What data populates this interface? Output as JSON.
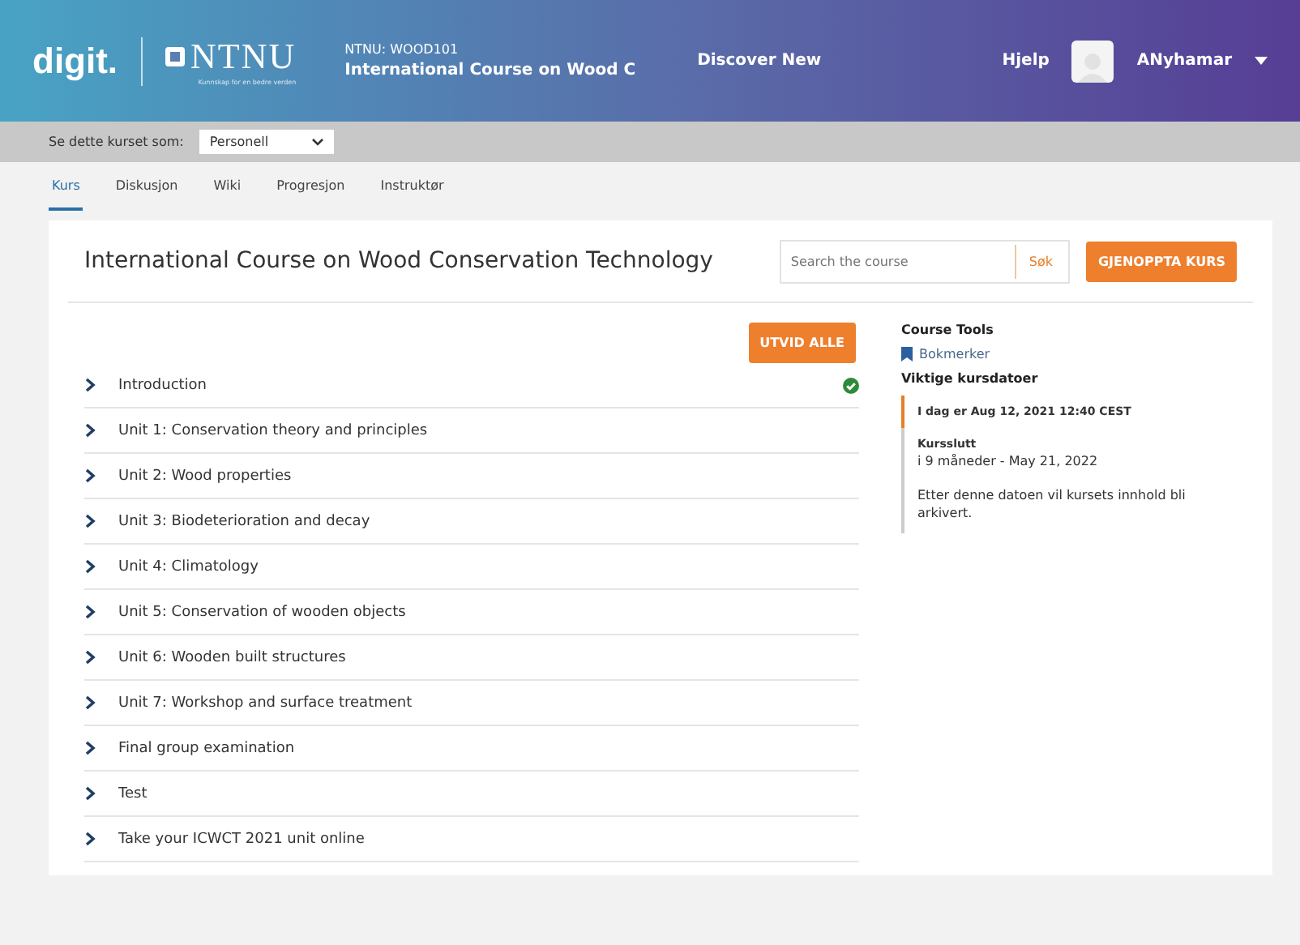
{
  "header": {
    "brand": "digit.",
    "logo": "NTNU",
    "tagline": "Kunnskap for en bedre verden",
    "course_code": "NTNU: WOOD101",
    "course_title": "International Course on Wood C",
    "nav_link": "Discover New",
    "help": "Hjelp",
    "username": "ANyhamar"
  },
  "view_as": {
    "label": "Se dette kurset som:",
    "value": "Personell"
  },
  "tabs": [
    {
      "label": "Kurs",
      "selected": true
    },
    {
      "label": "Diskusjon",
      "selected": false
    },
    {
      "label": "Wiki",
      "selected": false
    },
    {
      "label": "Progresjon",
      "selected": false
    },
    {
      "label": "Instruktør",
      "selected": false
    }
  ],
  "course": {
    "title": "International Course on Wood Conservation Technology",
    "search_placeholder": "Search the course",
    "search_button": "Søk",
    "resume_button": "GJENOPPTA KURS",
    "expand_button": "UTVID ALLE"
  },
  "sections": [
    {
      "title": "Introduction",
      "completed": true
    },
    {
      "title": "Unit 1: Conservation theory and principles",
      "completed": false
    },
    {
      "title": "Unit 2: Wood properties",
      "completed": false
    },
    {
      "title": "Unit 3: Biodeterioration and decay",
      "completed": false
    },
    {
      "title": "Unit 4: Climatology",
      "completed": false
    },
    {
      "title": "Unit 5: Conservation of wooden objects",
      "completed": false
    },
    {
      "title": "Unit 6: Wooden built structures",
      "completed": false
    },
    {
      "title": "Unit 7: Workshop and surface treatment",
      "completed": false
    },
    {
      "title": "Final group examination",
      "completed": false
    },
    {
      "title": "Test",
      "completed": false
    },
    {
      "title": "Take your ICWCT 2021 unit online",
      "completed": false
    }
  ],
  "sidebar": {
    "tools_heading": "Course Tools",
    "bookmarks": "Bokmerker",
    "dates_heading": "Viktige kursdatoer",
    "dates": [
      {
        "kind": "today",
        "title": "I dag er Aug 12, 2021 12:40 CEST"
      },
      {
        "kind": "deadline",
        "title": "Kursslutt",
        "detail": "i 9 måneder - May 21, 2022",
        "note": "Etter denne datoen vil kursets innhold bli arkivert."
      }
    ]
  }
}
